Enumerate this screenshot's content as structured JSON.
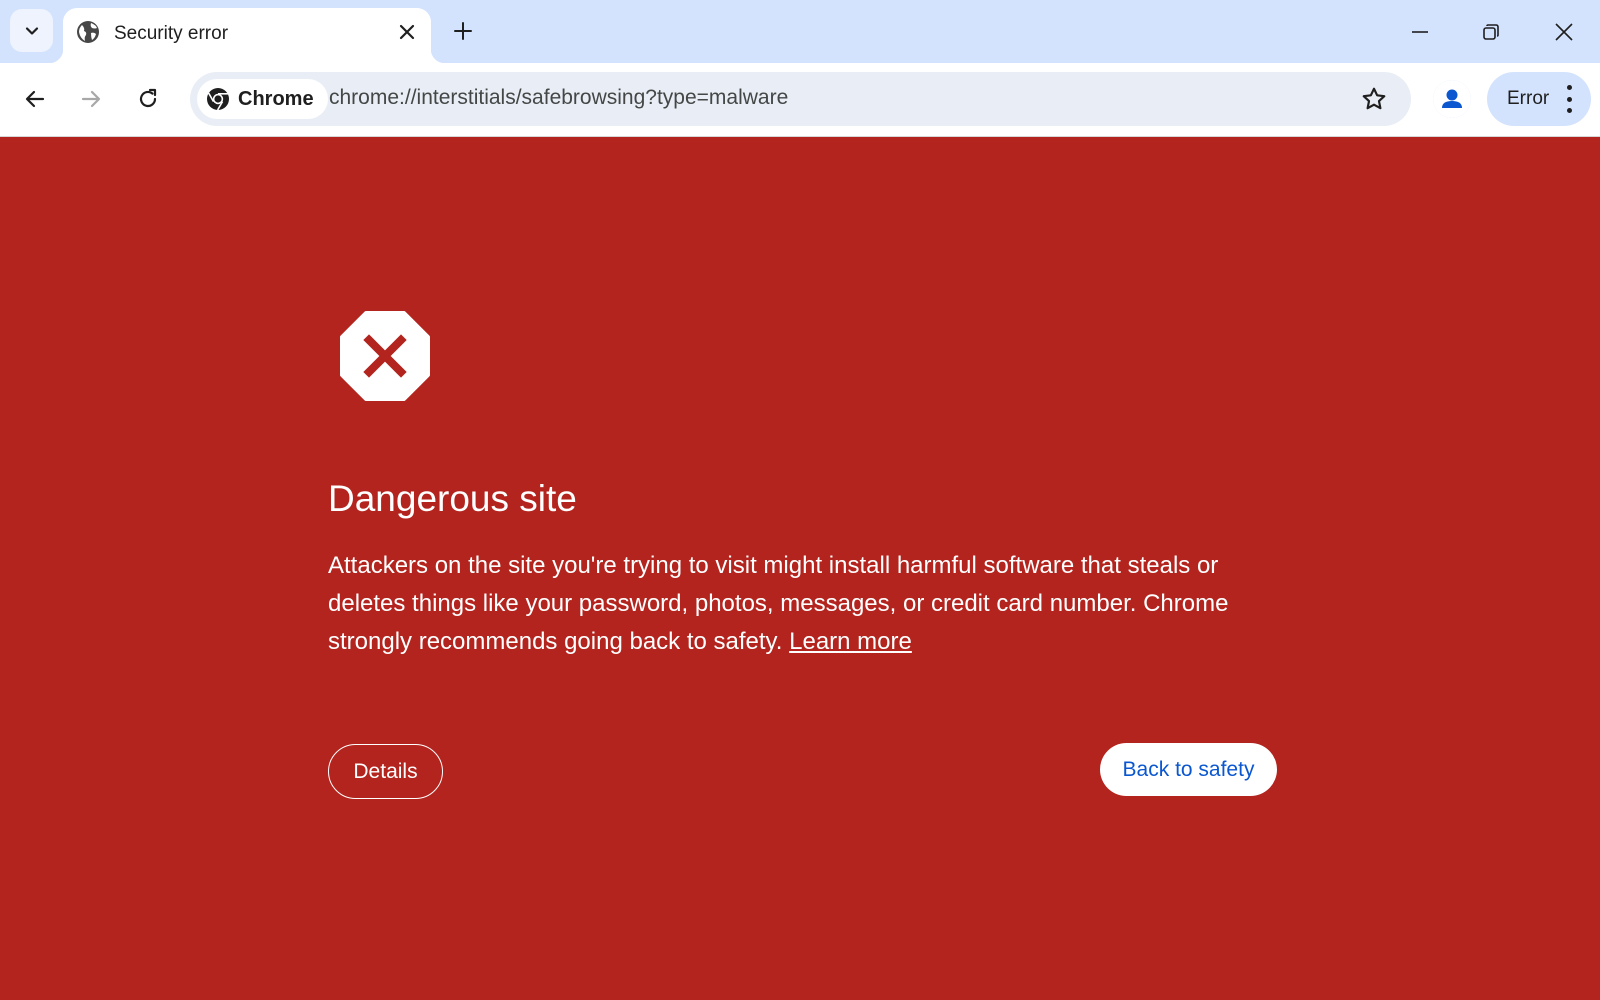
{
  "tab": {
    "title": "Security error"
  },
  "omnibox": {
    "chip_label": "Chrome",
    "url": "chrome://interstitials/safebrowsing?type=malware"
  },
  "profile_chip": {
    "label": "Error"
  },
  "icons": {
    "tab_search": "chevron-down-icon",
    "favicon": "globe-icon",
    "tab_close": "close-icon",
    "new_tab": "plus-icon",
    "minimize": "minimize-icon",
    "restore": "restore-icon",
    "window_close": "close-icon",
    "back": "arrow-left-icon",
    "forward": "arrow-right-icon",
    "reload": "reload-icon",
    "chrome": "chrome-logo-icon",
    "bookmark": "star-icon",
    "avatar": "person-icon",
    "menu": "kebab-menu-icon",
    "danger": "stop-octagon-x-icon"
  },
  "interstitial": {
    "heading": "Dangerous site",
    "description": "Attackers on the site you're trying to visit might install harmful software that steals or deletes things like your password, photos, messages, or credit card number. Chrome strongly recommends going back to safety.",
    "learn_more": "Learn more",
    "details_button": "Details",
    "back_button": "Back to safety"
  },
  "colors": {
    "tabstrip_bg": "#d3e3fd",
    "page_bg": "#b3241e",
    "primary_button_text": "#0b57d0",
    "omnibox_bg": "#e9eef6"
  }
}
